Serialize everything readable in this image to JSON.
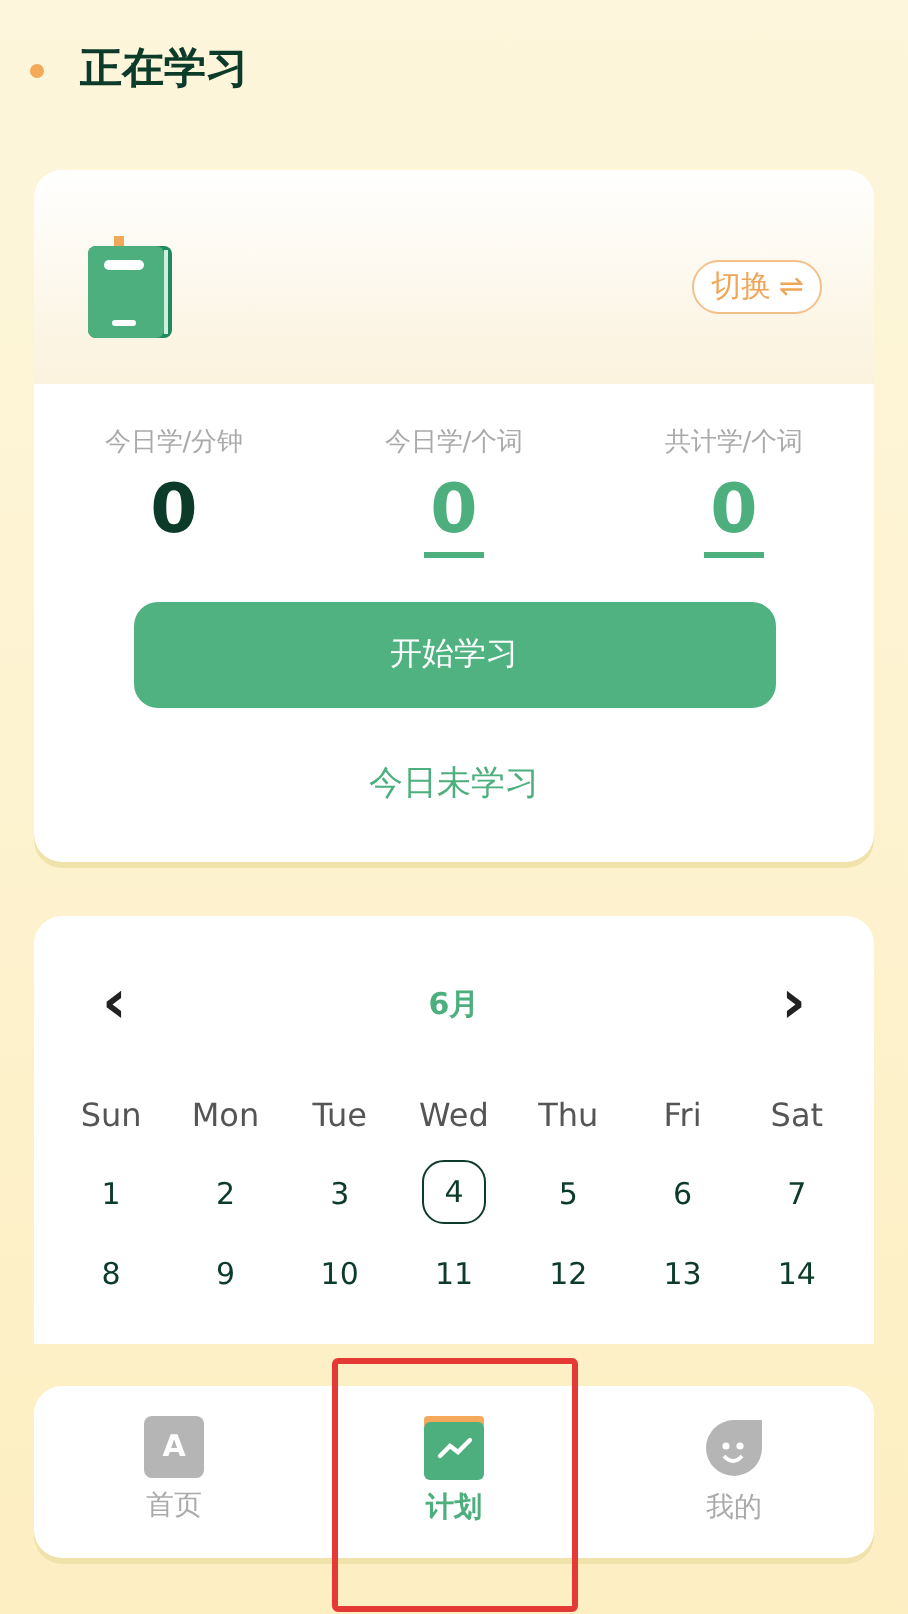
{
  "section_title": "正在学习",
  "study_card": {
    "switch_label": "切换",
    "switch_icon": "⇌",
    "stats": [
      {
        "label": "今日学/分钟",
        "value": "0",
        "kind": "plain"
      },
      {
        "label": "今日学/个词",
        "value": "0",
        "kind": "link"
      },
      {
        "label": "共计学/个词",
        "value": "0",
        "kind": "link"
      }
    ],
    "start_button": "开始学习",
    "status": "今日未学习"
  },
  "calendar": {
    "prev": "‹",
    "month": "6月",
    "next": "›",
    "weekdays": [
      "Sun",
      "Mon",
      "Tue",
      "Wed",
      "Thu",
      "Fri",
      "Sat"
    ],
    "days": [
      {
        "label": "1",
        "selected": false
      },
      {
        "label": "2",
        "selected": false
      },
      {
        "label": "3",
        "selected": false
      },
      {
        "label": "4",
        "selected": true
      },
      {
        "label": "5",
        "selected": false
      },
      {
        "label": "6",
        "selected": false
      },
      {
        "label": "7",
        "selected": false
      },
      {
        "label": "8",
        "selected": false
      },
      {
        "label": "9",
        "selected": false
      },
      {
        "label": "10",
        "selected": false
      },
      {
        "label": "11",
        "selected": false
      },
      {
        "label": "12",
        "selected": false
      },
      {
        "label": "13",
        "selected": false
      },
      {
        "label": "14",
        "selected": false
      }
    ]
  },
  "tabs": [
    {
      "label": "首页",
      "kind": "book",
      "icon_text": "A",
      "selected": false
    },
    {
      "label": "计划",
      "kind": "chart",
      "selected": true
    },
    {
      "label": "我的",
      "kind": "face",
      "selected": false
    }
  ]
}
